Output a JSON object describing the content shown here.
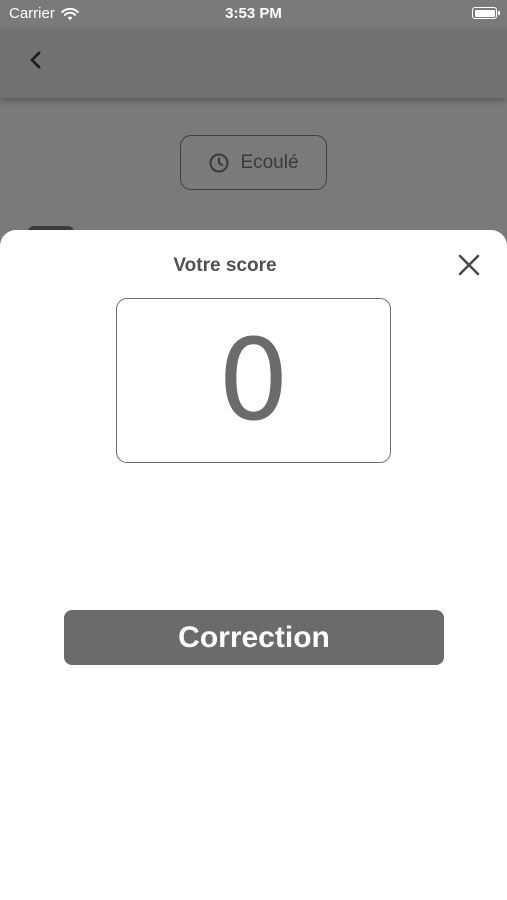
{
  "status_bar": {
    "carrier": "Carrier",
    "time": "3:53 PM",
    "icons": [
      "wifi-icon",
      "battery-icon"
    ]
  },
  "nav": {
    "back_icon": "chevron-left-icon"
  },
  "background": {
    "timer_label": "Ecoulé",
    "timer_icon": "clock-icon"
  },
  "score_sheet": {
    "title": "Votre score",
    "score": "0",
    "close_icon": "close-icon",
    "correction_label": "Correction"
  },
  "colors": {
    "overlay_bg": "#7a7a7a",
    "sheet_bg": "#ffffff",
    "button_bg": "#6b6b6b",
    "text": "#505050"
  }
}
